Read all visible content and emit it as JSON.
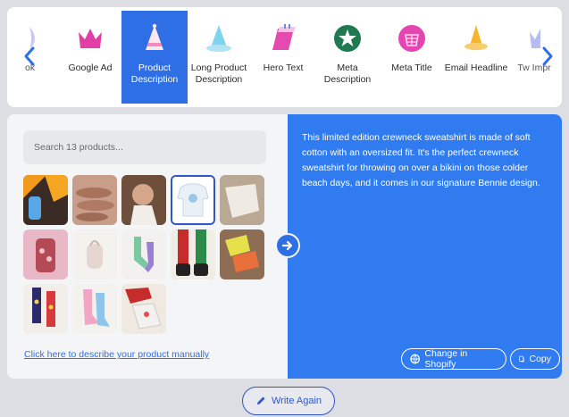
{
  "toolbar": {
    "tools": [
      {
        "label": "ok",
        "icon": "cutoff-icon"
      },
      {
        "label": "Google Ad",
        "icon": "crown-icon"
      },
      {
        "label": "Product Description",
        "icon": "party-hat-icon",
        "selected": true
      },
      {
        "label": "Long Product Description",
        "icon": "cone-hat-icon"
      },
      {
        "label": "Hero Text",
        "icon": "sliced-cake-icon"
      },
      {
        "label": "Meta Description",
        "icon": "starburst-icon"
      },
      {
        "label": "Meta Title",
        "icon": "gift-icon"
      },
      {
        "label": "Email Headline",
        "icon": "bell-cone-icon"
      },
      {
        "label": "Tw Impr",
        "icon": "cutoff-icon"
      }
    ]
  },
  "search": {
    "placeholder": "Search 13 products..."
  },
  "products": {
    "count": 13,
    "selected_index": 3,
    "items": [
      "product-thumb-1",
      "product-thumb-2",
      "product-thumb-3",
      "product-thumb-4",
      "product-thumb-5",
      "product-thumb-6",
      "product-thumb-7",
      "product-thumb-8",
      "product-thumb-9",
      "product-thumb-10",
      "product-thumb-11",
      "product-thumb-12",
      "product-thumb-13"
    ]
  },
  "manual_link": "Click here to describe your product manually",
  "output": {
    "text": "This limited edition crewneck sweatshirt is made of soft cotton with an oversized fit. It's the perfect crewneck sweatshirt for throwing on over a bikini on those colder beach days, and it comes in our signature Bennie design.",
    "change_label": "Change in Shopify",
    "copy_label": "Copy"
  },
  "write_again_label": "Write Again",
  "colors": {
    "accent": "#2f6fe6",
    "panel": "#2f7bef",
    "link": "#2f6fe6"
  }
}
